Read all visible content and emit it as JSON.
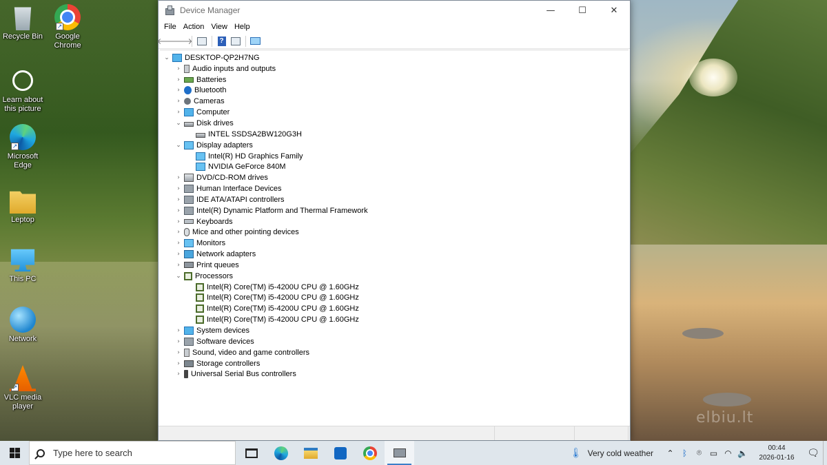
{
  "desktop": {
    "icons": [
      {
        "label": "Recycle Bin"
      },
      {
        "label": "Google Chrome"
      },
      {
        "label": "Learn about this picture"
      },
      {
        "label": "Microsoft Edge"
      },
      {
        "label": "Leptop"
      },
      {
        "label": "This PC"
      },
      {
        "label": "Network"
      },
      {
        "label": "VLC media player"
      }
    ],
    "watermark": "elbiu.lt"
  },
  "window": {
    "title": "Device Manager",
    "controls": {
      "minimize": "—",
      "maximize": "☐",
      "close": "✕"
    },
    "menu": [
      "File",
      "Action",
      "View",
      "Help"
    ],
    "toolbar": {
      "back": "🡐",
      "forward": "🡒",
      "help": "?"
    },
    "tree": {
      "root": "DESKTOP-QP2H7NG",
      "categories": [
        {
          "label": "Audio inputs and outputs"
        },
        {
          "label": "Batteries"
        },
        {
          "label": "Bluetooth"
        },
        {
          "label": "Cameras"
        },
        {
          "label": "Computer"
        },
        {
          "label": "Disk drives",
          "children": [
            "INTEL SSDSA2BW120G3H"
          ]
        },
        {
          "label": "Display adapters",
          "children": [
            "Intel(R) HD Graphics Family",
            "NVIDIA GeForce 840M"
          ]
        },
        {
          "label": "DVD/CD-ROM drives"
        },
        {
          "label": "Human Interface Devices"
        },
        {
          "label": "IDE ATA/ATAPI controllers"
        },
        {
          "label": "Intel(R) Dynamic Platform and Thermal Framework"
        },
        {
          "label": "Keyboards"
        },
        {
          "label": "Mice and other pointing devices"
        },
        {
          "label": "Monitors"
        },
        {
          "label": "Network adapters"
        },
        {
          "label": "Print queues"
        },
        {
          "label": "Processors",
          "children": [
            "Intel(R) Core(TM) i5-4200U CPU @ 1.60GHz",
            "Intel(R) Core(TM) i5-4200U CPU @ 1.60GHz",
            "Intel(R) Core(TM) i5-4200U CPU @ 1.60GHz",
            "Intel(R) Core(TM) i5-4200U CPU @ 1.60GHz"
          ]
        },
        {
          "label": "System devices"
        },
        {
          "label": "Software devices"
        },
        {
          "label": "Sound, video and game controllers"
        },
        {
          "label": "Storage controllers"
        },
        {
          "label": "Universal Serial Bus controllers"
        }
      ]
    }
  },
  "taskbar": {
    "search_placeholder": "Type here to search",
    "weather": "Very cold weather",
    "clock_time": "00:44",
    "clock_date": "2026-01-16",
    "tray_icons": [
      "chevron-up",
      "bluetooth",
      "camera",
      "battery",
      "wifi",
      "volume"
    ]
  }
}
